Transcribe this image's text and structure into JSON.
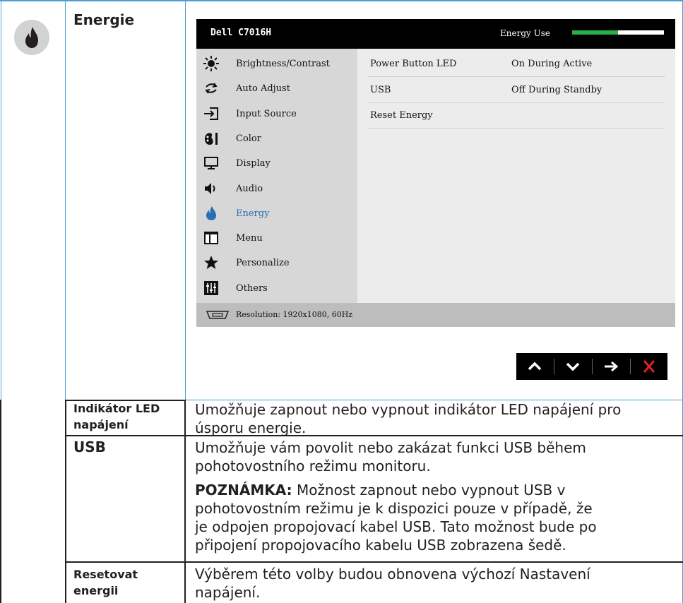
{
  "section": {
    "title": "Energie"
  },
  "osd": {
    "model": "Dell C7016H",
    "energy_use_label": "Energy Use",
    "energy_use_level": 0.5,
    "menu": [
      {
        "label": "Brightness/Contrast",
        "icon": "brightness-icon"
      },
      {
        "label": "Auto Adjust",
        "icon": "auto-adjust-icon"
      },
      {
        "label": "Input Source",
        "icon": "input-source-icon"
      },
      {
        "label": "Color",
        "icon": "color-icon"
      },
      {
        "label": "Display",
        "icon": "display-icon"
      },
      {
        "label": "Audio",
        "icon": "audio-icon"
      },
      {
        "label": "Energy",
        "icon": "energy-icon",
        "selected": true
      },
      {
        "label": "Menu",
        "icon": "menu-icon"
      },
      {
        "label": "Personalize",
        "icon": "star-icon"
      },
      {
        "label": "Others",
        "icon": "others-icon"
      }
    ],
    "rows": [
      {
        "label": "Power Button LED",
        "value": "On During Active"
      },
      {
        "label": "USB",
        "value": "Off During Standby"
      },
      {
        "label": "Reset Energy",
        "value": ""
      }
    ],
    "status": "Resolution: 1920x1080, 60Hz",
    "nav_buttons": [
      "up-arrow-icon",
      "down-arrow-icon",
      "right-arrow-icon",
      "close-icon"
    ]
  },
  "colors": {
    "accent_blue": "#4a9fd4",
    "energy_green": "#2ab04a",
    "close_red": "#e02020",
    "selected_blue": "#2a6fb4"
  },
  "table": [
    {
      "label_lines": [
        "Indikátor LED",
        "napájení"
      ],
      "desc_lines": [
        "Umožňuje zapnout nebo vypnout indikátor LED napájení pro",
        "úsporu energie."
      ]
    },
    {
      "label_lines": [
        "USB"
      ],
      "desc_lines": [
        "Umožňuje vám povolit nebo zakázat funkci USB během",
        "pohotovostního režimu monitoru."
      ],
      "note_bold": "POZNÁMKA:",
      "note_lines": [
        " Možnost zapnout nebo vypnout USB v",
        "pohotovostním režimu je k dispozici pouze v případě, že",
        "je odpojen propojovací kabel USB. Tato možnost bude po",
        "připojení propojovacího kabelu USB zobrazena šedě."
      ]
    },
    {
      "label_lines": [
        "Resetovat",
        "energii"
      ],
      "desc_lines": [
        "Výběrem této volby budou obnovena výchozí Nastavení",
        "napájení."
      ]
    }
  ]
}
